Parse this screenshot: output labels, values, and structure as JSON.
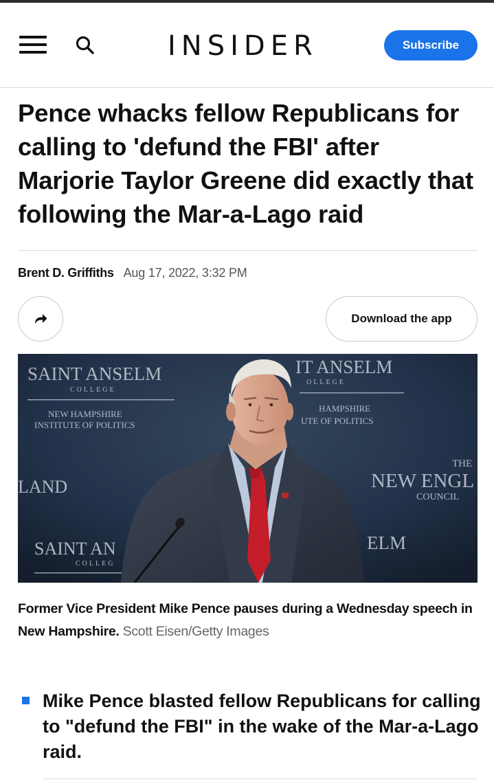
{
  "header": {
    "logo": "INSIDER",
    "subscribe_label": "Subscribe",
    "accent_color": "#1a73e8"
  },
  "icons": {
    "menu": "hamburger-menu-icon",
    "search": "search-icon",
    "share": "share-arrow-icon"
  },
  "article": {
    "headline": "Pence whacks fellow Republicans for calling to 'defund the FBI' after Marjorie Taylor Greene did exactly that following the Mar-a-Lago raid",
    "author": "Brent D. Griffiths",
    "date": "Aug 17, 2022, 3:32 PM",
    "download_label": "Download the app"
  },
  "photo": {
    "backdrop_text": {
      "left_title": "SAINT ANSELM",
      "left_college": "COLLEGE",
      "left_sub1": "NEW HAMPSHIRE",
      "left_sub2": "INSTITUTE OF POLITICS",
      "right_title": "IT ANSELM",
      "right_college": "OLLEGE",
      "right_sub1": "HAMPSHIRE",
      "right_sub2": "UTE OF POLITICS",
      "right_the": "THE",
      "right_neweng": "NEW ENGL",
      "right_council": "COUNCIL",
      "left_mid": "LAND",
      "bottom_left_title": "SAINT AN",
      "bottom_left_college": "COLLEG",
      "bottom_right": "ELM"
    },
    "caption": "Former Vice President Mike Pence pauses during a Wednesday speech in New Hampshire.",
    "credit": "Scott Eisen/Getty Images"
  },
  "key_points": [
    "Mike Pence blasted fellow Republicans for calling to \"defund the FBI\" in the wake of the Mar-a-Lago raid."
  ]
}
